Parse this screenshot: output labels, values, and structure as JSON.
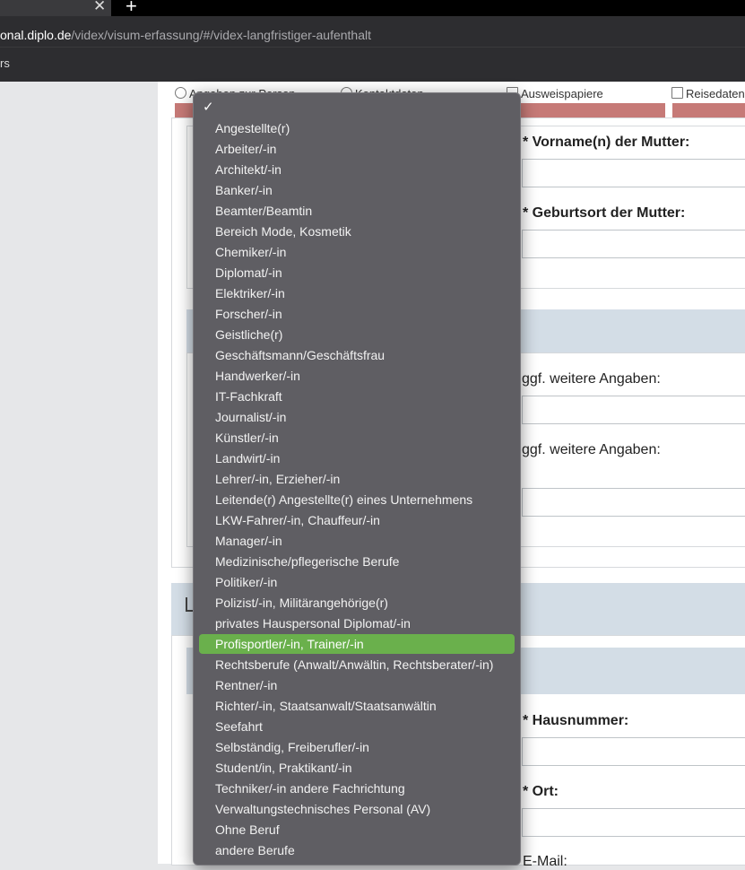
{
  "browser": {
    "url_domain_part": "onal.diplo.de",
    "url_path_part": "/videx/visum-erfassung/#/videx-langfristiger-aufenthalt",
    "tab_close_glyph": "✕",
    "new_tab_glyph": "+",
    "bookmarks_fragment": "rs"
  },
  "steps": [
    {
      "label": "Angaben zur Person",
      "icon": "person-icon"
    },
    {
      "label": "Kontaktdaten",
      "icon": "contact-icon"
    },
    {
      "label": "Ausweispapiere",
      "icon": "id-card-icon"
    },
    {
      "label": "Reisedaten",
      "icon": "map-icon"
    }
  ],
  "form": {
    "mother_first_name_label": "* Vorname(n) der Mutter:",
    "mother_birthplace_label": "* Geburtsort der Mutter:",
    "additional_info_label_1": "ggf. weitere Angaben:",
    "additional_info_label_2": "ggf. weitere Angaben:",
    "house_number_label": "* Hausnummer:",
    "city_label": "* Ort:",
    "email_label_fragment": "E-Mail:"
  },
  "dropdown": {
    "check_glyph": "✓",
    "selected_index": 25,
    "options": [
      "Angestellte(r)",
      "Arbeiter/-in",
      "Architekt/-in",
      "Banker/-in",
      "Beamter/Beamtin",
      "Bereich Mode, Kosmetik",
      "Chemiker/-in",
      "Diplomat/-in",
      "Elektriker/-in",
      "Forscher/-in",
      "Geistliche(r)",
      "Geschäftsmann/Geschäftsfrau",
      "Handwerker/-in",
      "IT-Fachkraft",
      "Journalist/-in",
      "Künstler/-in",
      "Landwirt/-in",
      "Lehrer/-in, Erzieher/-in",
      "Leitende(r) Angestellte(r) eines Unternehmens",
      "LKW-Fahrer/-in, Chauffeur/-in",
      "Manager/-in",
      "Medizinische/pflegerische Berufe",
      "Politiker/-in",
      "Polizist/-in, Militärangehörige(r)",
      "privates Hauspersonal Diplomat/-in",
      "Profisportler/-in, Trainer/-in",
      "Rechtsberufe (Anwalt/Anwältin, Rechtsberater/-in)",
      "Rentner/-in",
      "Richter/-in, Staatsanwalt/Staatsanwältin",
      "Seefahrt",
      "Selbständig, Freiberufler/-in",
      "Student/in, Praktikant/-in",
      "Techniker/-in andere Fachrichtung",
      "Verwaltungstechnisches Personal (AV)",
      "Ohne Beruf",
      "andere Berufe"
    ]
  }
}
